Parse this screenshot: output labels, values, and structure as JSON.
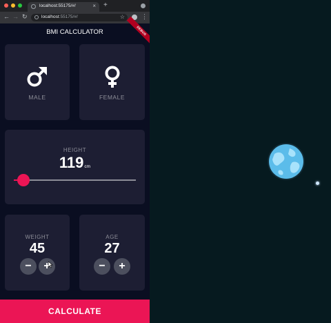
{
  "browser": {
    "tab_title": "localhost:55175/#/",
    "tab_close": "×",
    "new_tab": "+",
    "url_host": "localhost",
    "url_rest": ":55175/#/",
    "back": "←",
    "forward": "→",
    "reload": "↻",
    "bookmark": "☆",
    "menu": "⋮"
  },
  "app": {
    "title": "BMI CALCULATOR",
    "debug_banner": "DEBUG",
    "gender": {
      "male_label": "MALE",
      "female_label": "FEMALE"
    },
    "height": {
      "label": "HEIGHT",
      "value": "119",
      "unit": "cm",
      "slider_fraction": 0.08
    },
    "weight": {
      "label": "WEIGHT",
      "value": "45",
      "minus": "−",
      "plus": "+"
    },
    "age": {
      "label": "AGE",
      "value": "27",
      "minus": "−",
      "plus": "+"
    },
    "calculate_label": "CALCULATE"
  },
  "colors": {
    "background": "#0a0e21",
    "card": "#1d1e33",
    "accent": "#eb1555",
    "muted_text": "#8d8e98",
    "round_button": "#4c4f5e",
    "desktop": "#061a1f"
  }
}
